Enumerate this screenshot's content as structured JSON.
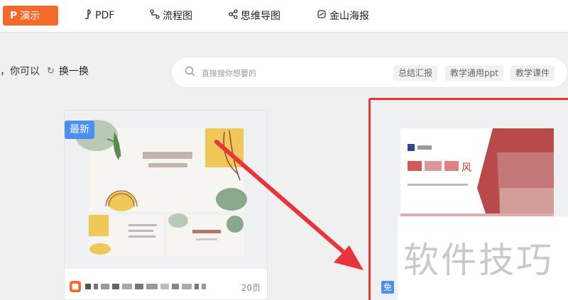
{
  "tabs": [
    {
      "label": "演示",
      "icon": "presentation-icon"
    },
    {
      "label": "PDF",
      "icon": "pdf-icon"
    },
    {
      "label": "流程图",
      "icon": "flowchart-icon"
    },
    {
      "label": "思维导图",
      "icon": "mindmap-icon"
    },
    {
      "label": "金山海报",
      "icon": "poster-icon"
    }
  ],
  "search_row": {
    "hint": "，你可以",
    "refresh_label": "换一换",
    "placeholder": "直接搜你想要的",
    "chips": [
      "总结汇报",
      "教学通用ppt",
      "教学课件"
    ]
  },
  "card1": {
    "badge": "最新",
    "pages": "20页"
  },
  "card2": {
    "free_badge": "免",
    "slide_title_char": "风"
  },
  "watermark": "软件技巧",
  "colors": {
    "accent": "#f26b2b",
    "badge_blue": "#4b8ff1",
    "highlight_red": "#e6363a"
  }
}
